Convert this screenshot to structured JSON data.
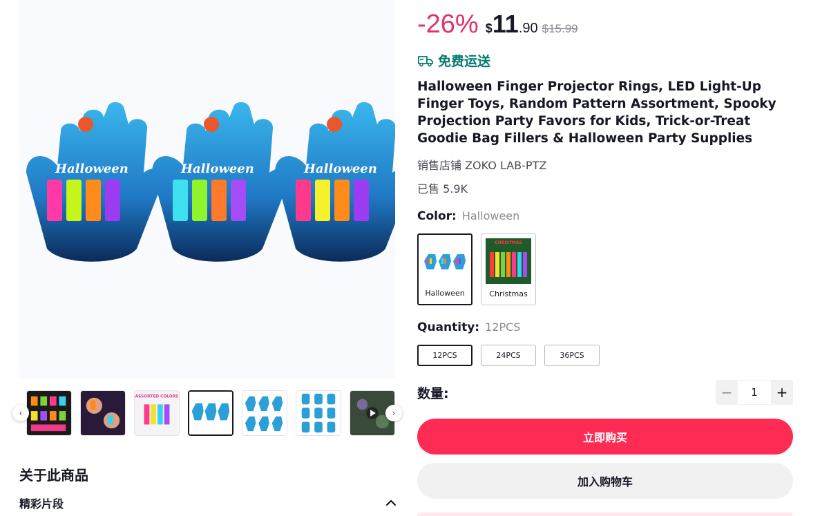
{
  "product": {
    "discount": "-26%",
    "currency": "$",
    "price_int": "11",
    "price_dec": ".90",
    "original_price": "$15.99",
    "shipping": "免费运送",
    "title": "Halloween Finger Projector Rings, LED Light-Up Finger Toys, Random Pattern Assortment, Spooky Projection Party Favors for Kids, Trick-or-Treat Goodie Bag Fillers & Halloween Party Supplies",
    "store": "销售店铺 ZOKO LAB-PTZ",
    "sold": "已售 5.9K",
    "packaging_text": "Halloween",
    "christmas_text": "CHRISTMAS"
  },
  "color": {
    "label": "Color:",
    "selected": "Halloween",
    "options": [
      {
        "label": "Halloween",
        "selected": true
      },
      {
        "label": "Christmas",
        "selected": false
      }
    ]
  },
  "quantity_option": {
    "label": "Quantity:",
    "selected": "12PCS",
    "options": [
      {
        "label": "12PCS",
        "selected": true
      },
      {
        "label": "24PCS",
        "selected": false
      },
      {
        "label": "36PCS",
        "selected": false
      }
    ]
  },
  "count": {
    "label": "数量:",
    "value": "1",
    "minus": "−",
    "plus": "+"
  },
  "actions": {
    "buy_now": "立即购买",
    "add_to_cart": "加入购物车"
  },
  "gallery": {
    "prev": "‹",
    "next": "›",
    "selected_index": 3,
    "thumb_badge": "ASSORTED COLORS"
  },
  "about": {
    "title": "关于此商品",
    "highlights": "精彩片段"
  },
  "colors": {
    "accent_red": "#fe2c55",
    "discount_pink": "#e2316a",
    "shipping_teal": "#00796b",
    "package_blue": "#2a9fd8"
  }
}
